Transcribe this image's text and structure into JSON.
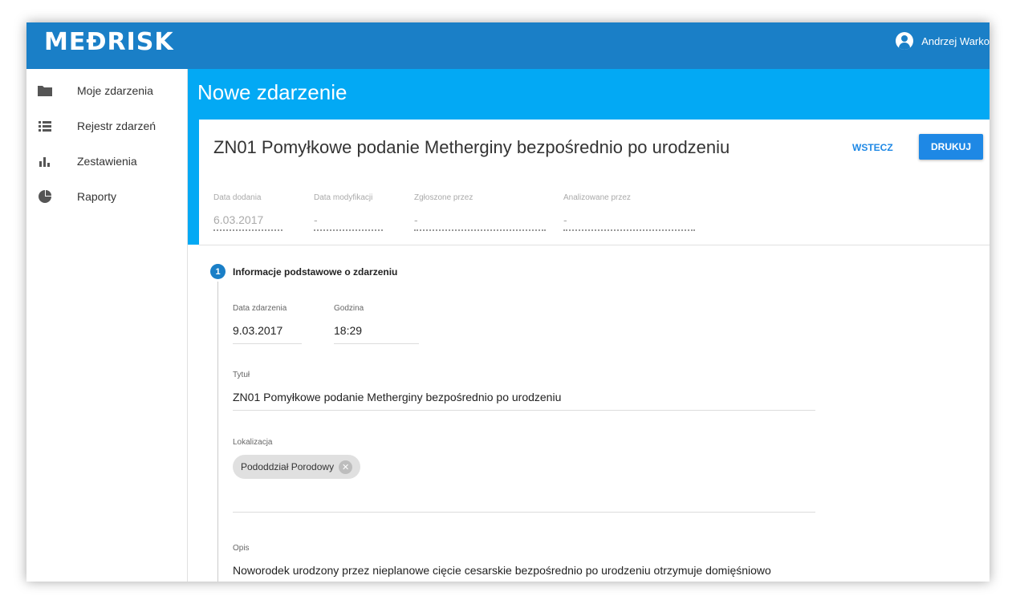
{
  "app": {
    "logo": "MEĐRISK",
    "user_name": "Andrzej Warko"
  },
  "sidebar": {
    "items": [
      {
        "label": "Moje zdarzenia",
        "icon": "folder-icon"
      },
      {
        "label": "Rejestr zdarzeń",
        "icon": "list-icon"
      },
      {
        "label": "Zestawienia",
        "icon": "bar-chart-icon"
      },
      {
        "label": "Raporty",
        "icon": "pie-chart-icon"
      }
    ]
  },
  "page": {
    "title": "Nowe zdarzenie"
  },
  "card": {
    "title": "ZN01 Pomyłkowe podanie Metherginy bezpośrednio po urodzeniu",
    "back_label": "WSTECZ",
    "print_label": "DRUKUJ",
    "meta": [
      {
        "label": "Data dodania",
        "value": "6.03.2017"
      },
      {
        "label": "Data modyfikacji",
        "value": "-"
      },
      {
        "label": "Zgłoszone przez",
        "value": "-"
      },
      {
        "label": "Analizowane przez",
        "value": "-"
      }
    ]
  },
  "section": {
    "number": "1",
    "title": "Informacje podstawowe o zdarzeniu",
    "date_label": "Data zdarzenia",
    "date_value": "9.03.2017",
    "time_label": "Godzina",
    "time_value": "18:29",
    "title_label": "Tytuł",
    "title_value": "ZN01 Pomyłkowe podanie Metherginy bezpośrednio po urodzeniu",
    "location_label": "Lokalizacja",
    "location_chip": "Pododdział Porodowy",
    "description_label": "Opis",
    "description_value": "Noworodek urodzony przez nieplanowe cięcie cesarskie bezpośrednio po urodzeniu otrzymuje domięśniowo"
  }
}
